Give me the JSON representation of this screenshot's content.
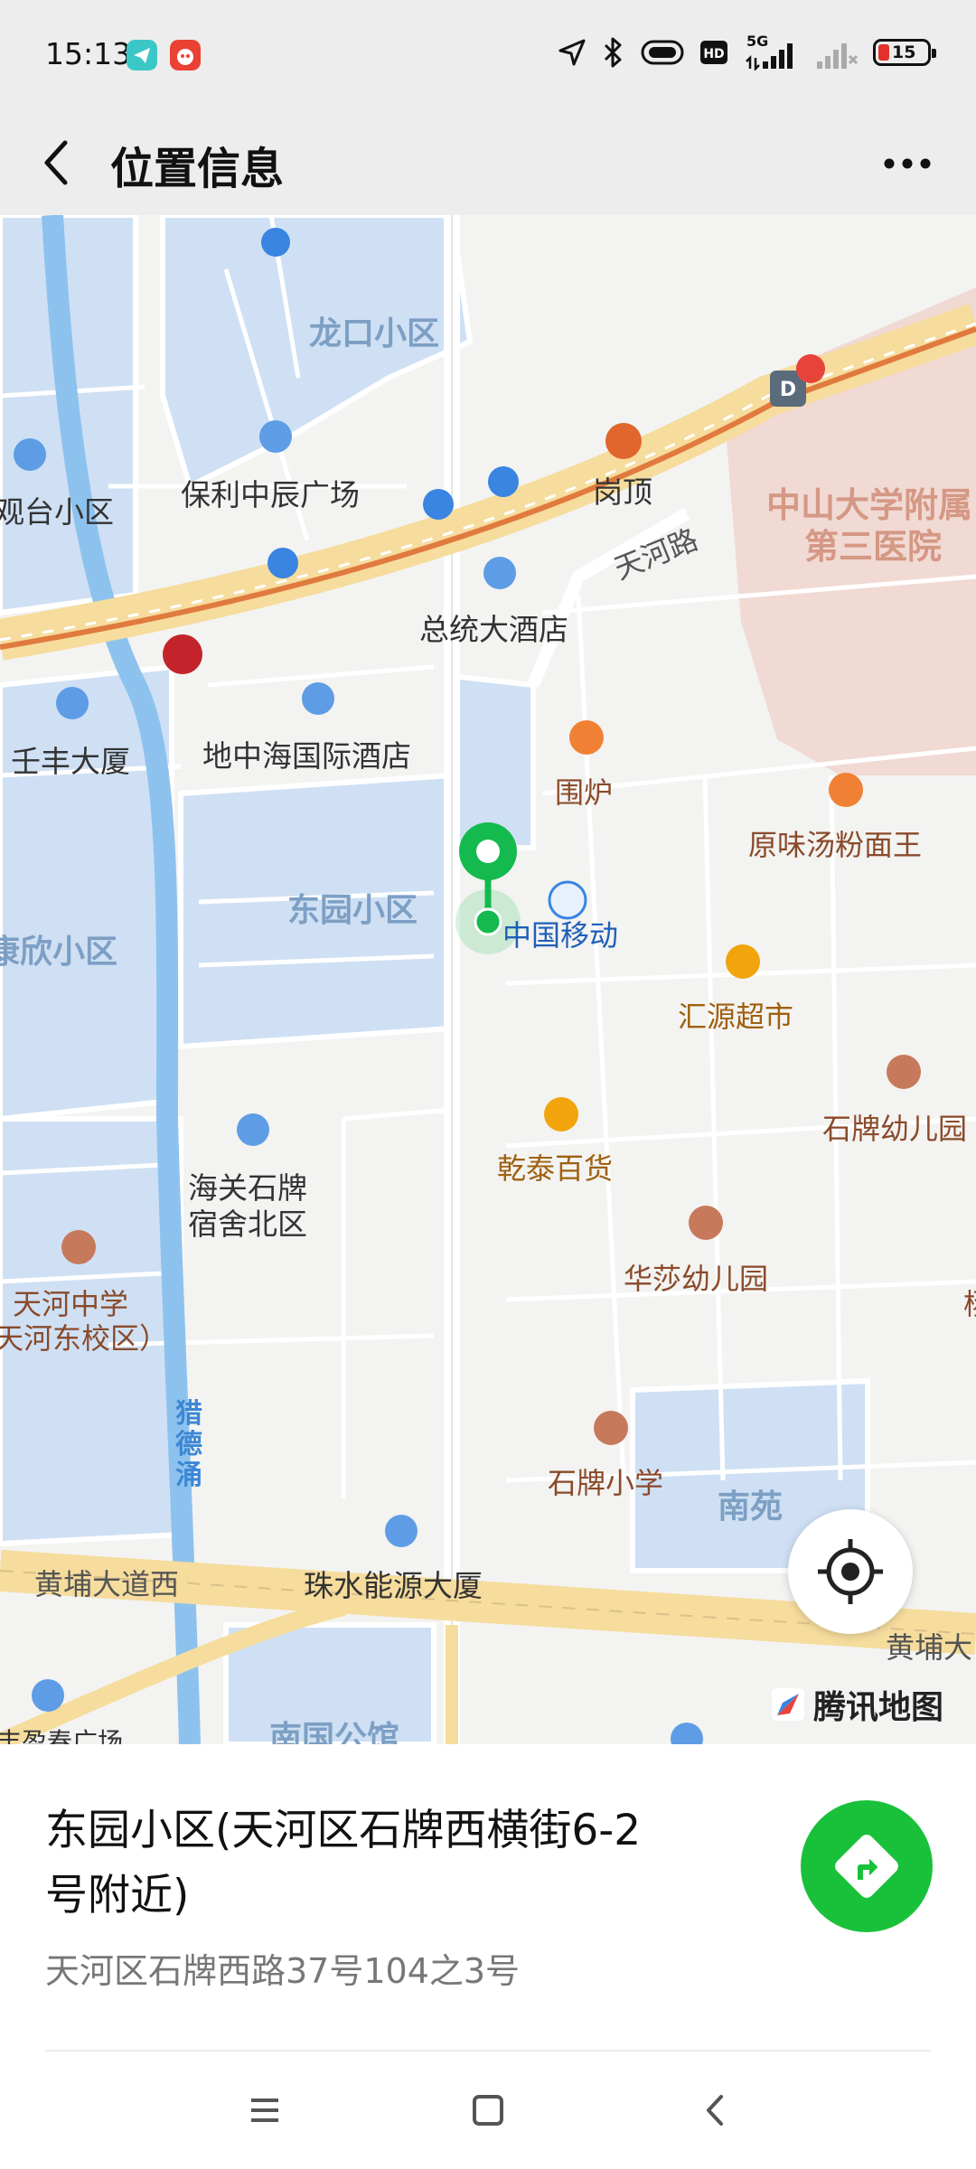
{
  "status_bar": {
    "time": "15:13",
    "network": "5G",
    "battery": "15",
    "icons": [
      "telegram-icon",
      "red-app-icon",
      "location-arrow-icon",
      "bluetooth-icon",
      "vibrate-icon",
      "hd-icon",
      "signal-icon",
      "signal-weak-icon",
      "battery-icon"
    ]
  },
  "header": {
    "title": "位置信息",
    "back_icon": "chevron-left-icon",
    "more_icon": "more-dots-icon"
  },
  "map": {
    "provider_logo": "腾讯地图",
    "labels": {
      "longkou": "龙口小区",
      "baoli": "保利中辰广场",
      "guantai": "观台小区",
      "gangding": "岗顶",
      "hospital_line1": "中山大学附属",
      "hospital_line2": "第三医院",
      "tianhe_road": "天河路",
      "zongtong": "总统大酒店",
      "renfeng": "壬丰大厦",
      "dizhonghai": "地中海国际酒店",
      "weilu": "围炉",
      "yuanwei": "原味汤粉面王",
      "dongyuan": "东园小区",
      "xin": "康欣小区",
      "cmcc": "中国移动",
      "huiyuan": "汇源超市",
      "shipai_kinder": "石牌幼儿园",
      "qiantai": "乾泰百货",
      "haiguan_line1": "海关石牌",
      "haiguan_line2": "宿舍北区",
      "huasha": "华莎幼儿园",
      "tianhe_middle_line1": "天河中学",
      "tianhe_middle_line2": "天河东校区）",
      "liedechong": [
        "猎",
        "德",
        "涌"
      ],
      "shipai_primary": "石牌小学",
      "nanyuan": "南苑",
      "huangpu_west": "黄埔大道西",
      "zhushui": "珠水能源大厦",
      "huangpu_east": "黄埔大",
      "nanguo": "南国公馆",
      "yingchun": "丰盈春广场",
      "yang": "杨"
    },
    "colors": {
      "residential": "#cfe0f4",
      "hospital": "#f1d9d4",
      "road_major": "#f6dc9d",
      "water": "#8ec2ee",
      "pin": "#14ba4e"
    }
  },
  "place": {
    "name": "东园小区(天河区石牌西横街6-2号附近)",
    "address": "天河区石牌西路37号104之3号",
    "navigate_icon": "navigate-arrow-icon"
  },
  "system_nav": {
    "icons": [
      "menu-icon",
      "home-icon",
      "back-icon"
    ]
  }
}
